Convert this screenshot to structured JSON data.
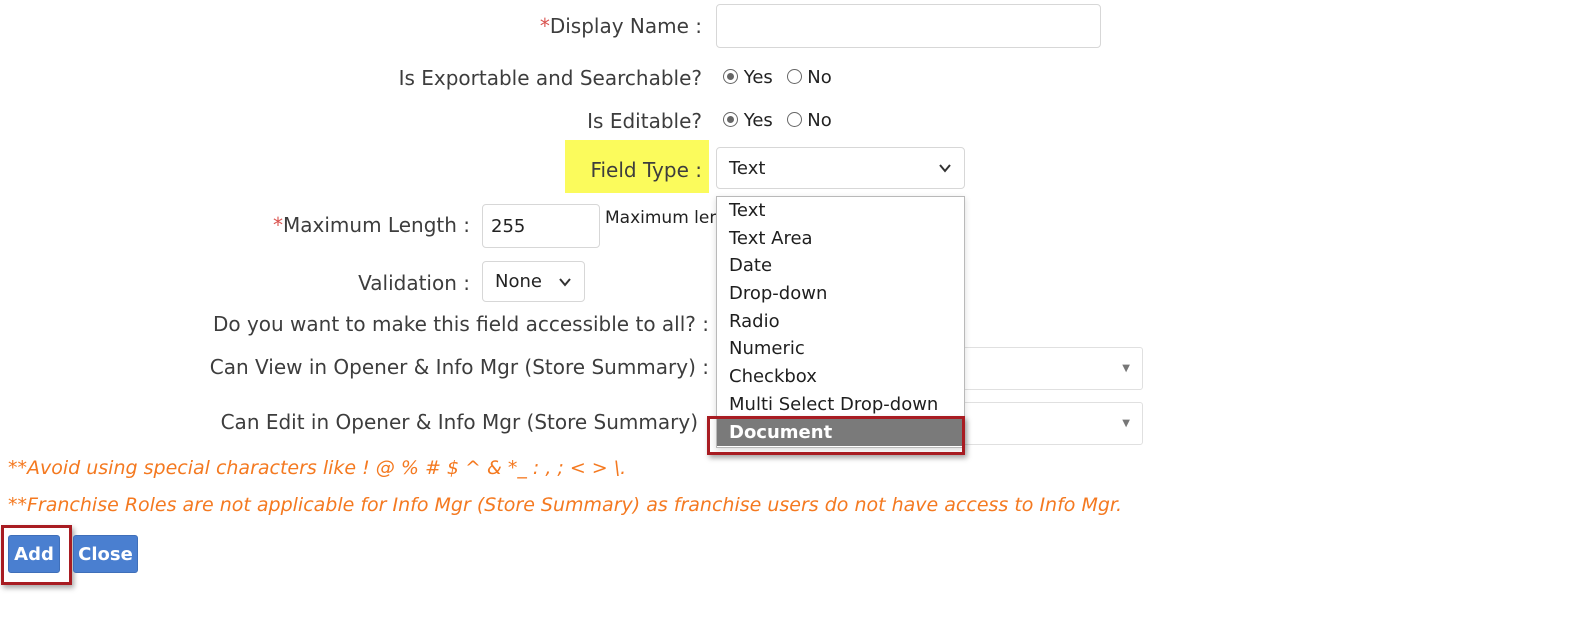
{
  "form": {
    "display_name": {
      "required_mark": "*",
      "label": "Display Name :",
      "value": ""
    },
    "exportable": {
      "label": "Is Exportable and Searchable?",
      "yes": "Yes",
      "no": "No",
      "selected": "Yes"
    },
    "editable": {
      "label": "Is Editable?",
      "yes": "Yes",
      "no": "No",
      "selected": "Yes"
    },
    "field_type": {
      "label": "Field Type :",
      "value": "Text",
      "options": [
        "Text",
        "Text Area",
        "Date",
        "Drop-down",
        "Radio",
        "Numeric",
        "Checkbox",
        "Multi Select Drop-down",
        "Document"
      ],
      "highlighted_option": "Document"
    },
    "max_length": {
      "required_mark": "*",
      "label": "Maximum Length :",
      "value": "255",
      "hint": "Maximum len"
    },
    "validation": {
      "label": "Validation :",
      "value": "None"
    },
    "accessible": {
      "label": "Do you want to make this field accessible to all? :"
    },
    "can_view": {
      "label": "Can View in Opener & Info Mgr (Store Summary) :"
    },
    "can_edit": {
      "label": "Can Edit in Opener & Info Mgr (Store Summary)"
    }
  },
  "notes": {
    "special_chars": "**Avoid using special characters like ! @ % # $ ^ & *_ : , ; < > \\.",
    "franchise": "**Franchise Roles are not applicable for Info Mgr (Store Summary) as franchise users do not have access to Info Mgr."
  },
  "buttons": {
    "add": "Add",
    "close": "Close"
  },
  "colors": {
    "required": "#d9534f",
    "note": "#f47920",
    "button": "#4a7fd0",
    "highlight_yellow": "#fbfb5c",
    "callout_red": "#a81c22",
    "selected_option": "#7a7a7a"
  },
  "icons": {
    "dropdown": "chevron-down-icon",
    "select_arrow": "triangle-down-icon"
  }
}
